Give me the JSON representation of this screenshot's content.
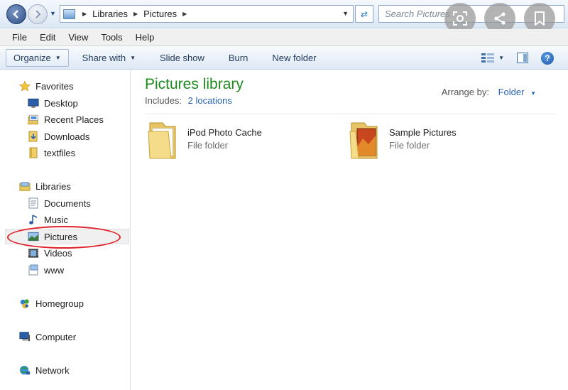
{
  "address_bar": {
    "crumbs": [
      "Libraries",
      "Pictures"
    ],
    "search_placeholder": "Search Pictures"
  },
  "menu": [
    "File",
    "Edit",
    "View",
    "Tools",
    "Help"
  ],
  "command_bar": {
    "organize": "Organize",
    "share_with": "Share with",
    "slide_show": "Slide show",
    "burn": "Burn",
    "new_folder": "New folder"
  },
  "nav": {
    "favorites": "Favorites",
    "desktop": "Desktop",
    "recent_places": "Recent Places",
    "downloads": "Downloads",
    "textfiles": "textfiles",
    "libraries": "Libraries",
    "documents": "Documents",
    "music": "Music",
    "pictures": "Pictures",
    "videos": "Videos",
    "www": "www",
    "homegroup": "Homegroup",
    "computer": "Computer",
    "network": "Network",
    "selected": "Pictures"
  },
  "content": {
    "title": "Pictures library",
    "includes_label": "Includes:",
    "includes_link": "2 locations",
    "arrange_label": "Arrange by:",
    "arrange_value": "Folder",
    "items": [
      {
        "name": "iPod Photo Cache",
        "type": "File folder"
      },
      {
        "name": "Sample Pictures",
        "type": "File folder"
      }
    ]
  },
  "colors": {
    "title_green": "#1e8a1e",
    "link_blue": "#2a64b5",
    "highlight_red": "#e0202a"
  }
}
